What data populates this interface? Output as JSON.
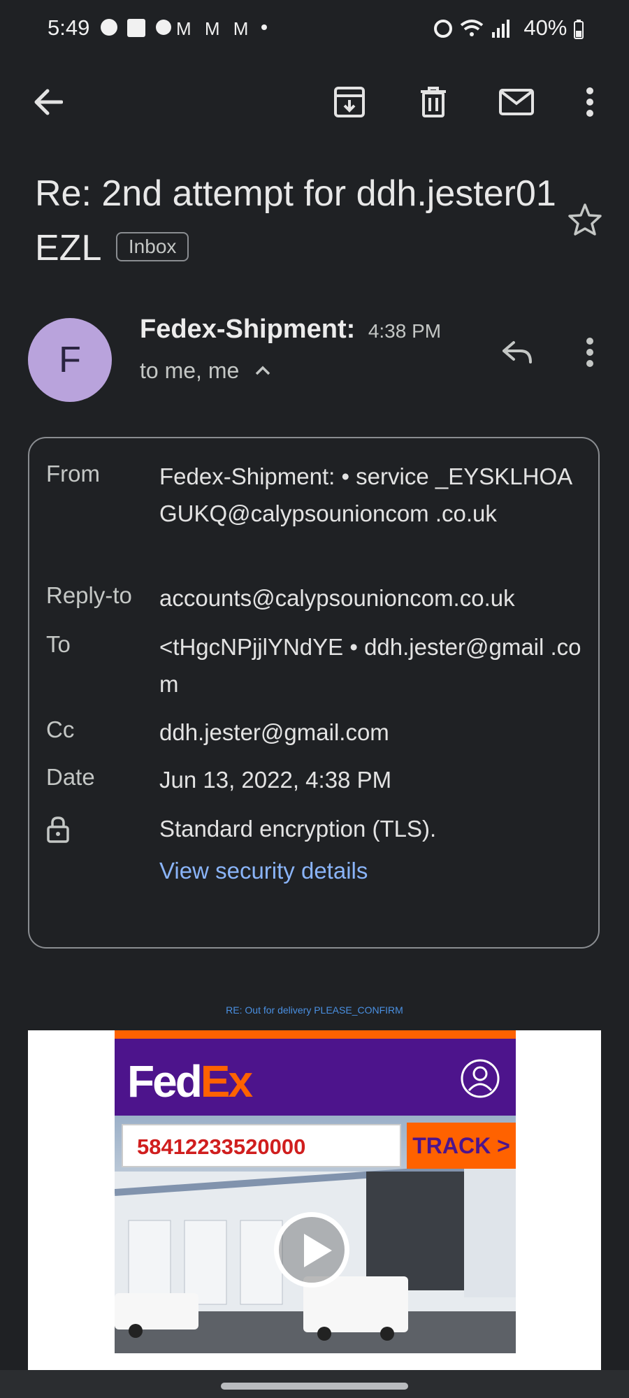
{
  "status_bar": {
    "time": "5:49",
    "battery": "40%"
  },
  "toolbar": {
    "back_icon": "arrow-left-icon",
    "archive_icon": "archive-icon",
    "delete_icon": "trash-icon",
    "mark_unread_icon": "mail-icon",
    "more_icon": "more-vert-icon"
  },
  "email": {
    "subject": "Re: 2nd attempt for ddh.jester01 EZL",
    "label": "Inbox",
    "sender_initial": "F",
    "sender_name": "Fedex-Shipment:",
    "time": "4:38 PM",
    "recipients": "to me, me"
  },
  "details": {
    "rows": [
      {
        "label": "From",
        "value": "Fedex-Shipment: • service _EYSKLHOAGUKQ@calypsounioncom .co.uk"
      },
      {
        "label": "Reply-to",
        "value": "accounts@calypsounioncom.co.uk"
      },
      {
        "label": "To",
        "value": "<tHgcNPjjlYNdYE • ddh.jester@gmail .com"
      },
      {
        "label": "Cc",
        "value": "ddh.jester@gmail.com"
      },
      {
        "label": "Date",
        "value": "Jun 13, 2022, 4:38 PM"
      }
    ],
    "encryption": "Standard encryption (TLS).",
    "security_link": "View security details"
  },
  "body": {
    "preheader": "RE: Out for delivery PLEASE_CONFIRM",
    "logo_fed": "Fed",
    "logo_ex": "Ex",
    "tracking_number": "58412233520000",
    "track_button": "TRACK >"
  },
  "colors": {
    "background": "#1f2124",
    "avatar": "#b9a3dc",
    "link": "#8ab4f8",
    "fedex_purple": "#4d148c",
    "fedex_orange": "#ff6200"
  }
}
